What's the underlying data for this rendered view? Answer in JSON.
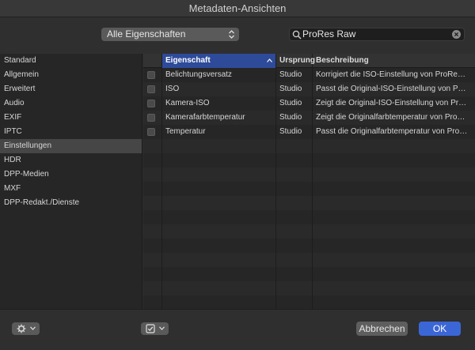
{
  "window": {
    "title": "Metadaten-Ansichten"
  },
  "toolbar": {
    "popup_value": "Alle Eigenschaften",
    "search_value": "ProRes Raw"
  },
  "sidebar": {
    "items": [
      {
        "label": "Standard"
      },
      {
        "label": "Allgemein"
      },
      {
        "label": "Erweitert"
      },
      {
        "label": "Audio"
      },
      {
        "label": "EXIF"
      },
      {
        "label": "IPTC"
      },
      {
        "label": "Einstellungen",
        "selected": true
      },
      {
        "label": "HDR"
      },
      {
        "label": "DPP-Medien"
      },
      {
        "label": "MXF"
      },
      {
        "label": "DPP-Redakt./Dienste"
      }
    ]
  },
  "table": {
    "columns": {
      "property": "Eigenschaft",
      "origin": "Ursprung",
      "description": "Beschreibung"
    },
    "rows": [
      {
        "property": "Belichtungsversatz",
        "origin": "Studio",
        "description": "Korrigiert die ISO-Einstellung von ProRe…"
      },
      {
        "property": "ISO",
        "origin": "Studio",
        "description": "Passt die Original-ISO-Einstellung von P…"
      },
      {
        "property": "Kamera-ISO",
        "origin": "Studio",
        "description": "Zeigt die Original-ISO-Einstellung von Pr…"
      },
      {
        "property": "Kamerafarbtemperatur",
        "origin": "Studio",
        "description": "Zeigt die Originalfarbtemperatur von Pro…"
      },
      {
        "property": "Temperatur",
        "origin": "Studio",
        "description": "Passt die Originalfarbtemperatur von Pro…"
      }
    ]
  },
  "footer": {
    "cancel_label": "Abbrechen",
    "ok_label": "OK"
  },
  "colors": {
    "accent": "#3b66d6",
    "header_active": "#2e4b9a",
    "selection": "#464646"
  },
  "icons": {
    "popup": "updown-arrows-icon",
    "search": "magnifier-icon",
    "clear": "clear-circle-icon",
    "settings": "gear-icon",
    "checkbox_menu": "checkbox-icon"
  }
}
